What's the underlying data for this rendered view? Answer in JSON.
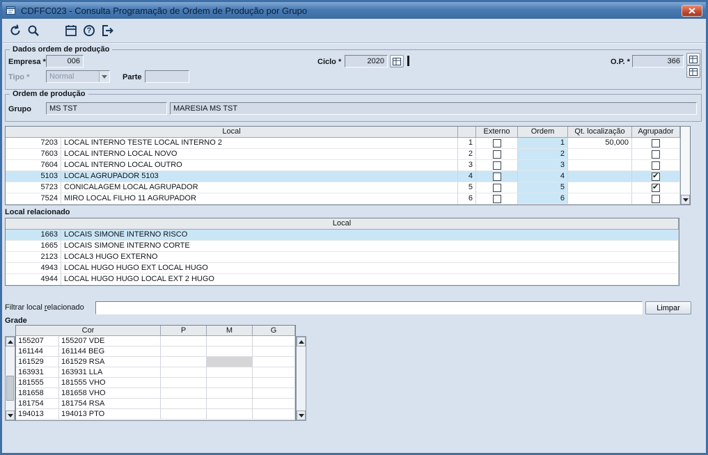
{
  "window": {
    "title": "CDFFC023 - Consulta Programação de Ordem de Produção por Grupo"
  },
  "toolbar": {
    "help_glyph": "?",
    "buttons": [
      "undo",
      "search",
      "calendar",
      "help",
      "exit"
    ]
  },
  "colors": {
    "frame": "#3f6fa7",
    "titlebar": "#4a7ab2",
    "background": "#d8e2ee",
    "selection": "#c9e6f7",
    "close_button": "#c14a32",
    "disabled_field": "#d2dbe7"
  },
  "dados": {
    "group_title": "Dados ordem de produção",
    "empresa_label": "Empresa *",
    "empresa_value": "006",
    "ciclo_label": "Ciclo *",
    "ciclo_value": "2020",
    "op_label": "O.P. *",
    "op_value": "366",
    "tipo_label": "Tipo *",
    "tipo_value": "Normal",
    "parte_label": "Parte",
    "parte_value": ""
  },
  "ordem": {
    "group_title": "Ordem de produção",
    "grupo_label": "Grupo",
    "grupo_code": "MS TST",
    "grupo_name": "MARESIA MS TST"
  },
  "locais": {
    "headers": {
      "local": "Local",
      "externo": "Externo",
      "ordem": "Ordem",
      "qt": "Qt. localização",
      "agrupador": "Agrupador"
    },
    "rows": [
      {
        "code": "7203",
        "name": "LOCAL INTERNO TESTE LOCAL INTERNO 2",
        "seq": "1",
        "externo": false,
        "ordem": "1",
        "qt": "50,000",
        "agrupador": false,
        "selected": false
      },
      {
        "code": "7603",
        "name": "LOCAL INTERNO LOCAL NOVO",
        "seq": "2",
        "externo": false,
        "ordem": "2",
        "qt": "",
        "agrupador": false,
        "selected": false
      },
      {
        "code": "7604",
        "name": "LOCAL INTERNO LOCAL OUTRO",
        "seq": "3",
        "externo": false,
        "ordem": "3",
        "qt": "",
        "agrupador": false,
        "selected": false
      },
      {
        "code": "5103",
        "name": "LOCAL AGRUPADOR 5103",
        "seq": "4",
        "externo": false,
        "ordem": "4",
        "qt": "",
        "agrupador": true,
        "selected": true
      },
      {
        "code": "5723",
        "name": "CONICALAGEM LOCAL AGRUPADOR",
        "seq": "5",
        "externo": false,
        "ordem": "5",
        "qt": "",
        "agrupador": true,
        "selected": false
      },
      {
        "code": "7524",
        "name": "MIRO LOCAL FILHO 11 AGRUPADOR",
        "seq": "6",
        "externo": false,
        "ordem": "6",
        "qt": "",
        "agrupador": false,
        "selected": false
      }
    ]
  },
  "relacionado": {
    "group_title": "Local relacionado",
    "header_local": "Local",
    "rows": [
      {
        "code": "1663",
        "name": "LOCAIS SIMONE INTERNO RISCO",
        "selected": true
      },
      {
        "code": "1665",
        "name": "LOCAIS SIMONE INTERNO CORTE",
        "selected": false
      },
      {
        "code": "2123",
        "name": "LOCAL3 HUGO EXTERNO",
        "selected": false
      },
      {
        "code": "4943",
        "name": "LOCAL HUGO HUGO EXT LOCAL HUGO",
        "selected": false
      },
      {
        "code": "4944",
        "name": "LOCAL HUGO HUGO LOCAL EXT 2 HUGO",
        "selected": false
      }
    ]
  },
  "filtro": {
    "label_pre": "Filtrar local ",
    "label_accel": "r",
    "label_post": "elacionado",
    "value": "",
    "limpar_label": "Limpar"
  },
  "grade": {
    "group_title": "Grade",
    "headers": {
      "cor": "Cor",
      "p": "P",
      "m": "M",
      "g": "G"
    },
    "rows": [
      {
        "code": "155207",
        "desc": "155207 VDE",
        "m_selected": false
      },
      {
        "code": "161144",
        "desc": "161144 BEG",
        "m_selected": false
      },
      {
        "code": "161529",
        "desc": "161529 RSA",
        "m_selected": true
      },
      {
        "code": "163931",
        "desc": "163931 LLA",
        "m_selected": false
      },
      {
        "code": "181555",
        "desc": "181555 VHO",
        "m_selected": false
      },
      {
        "code": "181658",
        "desc": "181658 VHO",
        "m_selected": false
      },
      {
        "code": "181754",
        "desc": "181754 RSA",
        "m_selected": false
      },
      {
        "code": "194013",
        "desc": "194013 PTO",
        "m_selected": false
      }
    ]
  }
}
